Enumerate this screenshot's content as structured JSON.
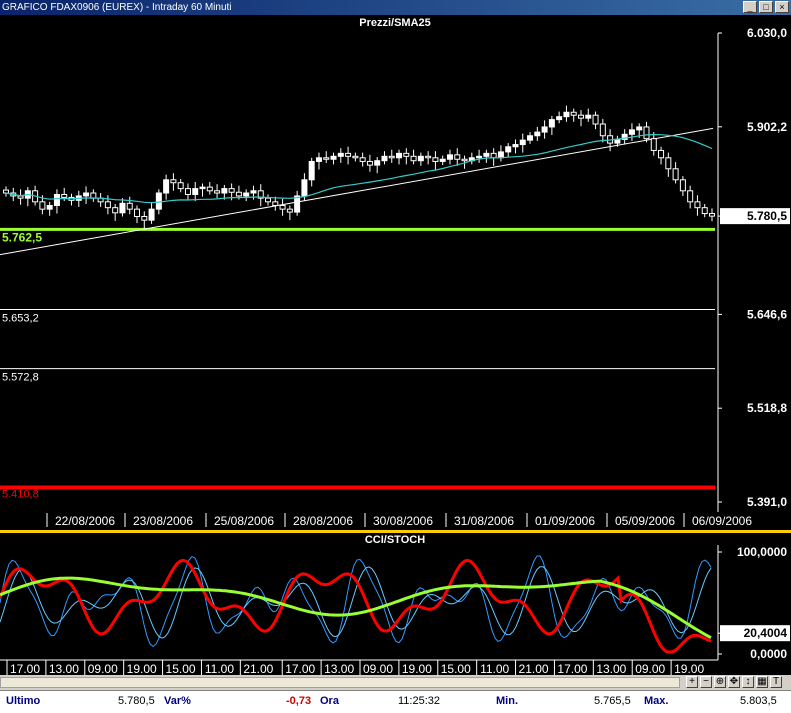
{
  "window": {
    "title": "GRAFICO FDAX0906 (EUREX) - Intraday 60 Minuti",
    "buttons": [
      "_",
      "□",
      "×"
    ]
  },
  "chart_data": [
    {
      "type": "candlestick",
      "title": "Prezzi/SMA25",
      "series": [
        {
          "name": "Prezzi"
        },
        {
          "name": "SMA25"
        }
      ],
      "y_ticks": [
        "6.030,0",
        "5.902,2",
        "5.780,5",
        "5.646,6",
        "5.518,8",
        "5.391,0"
      ],
      "ylim": [
        5391.0,
        6030.0
      ],
      "last_price": 5780.5,
      "last_price_label": "5.780,5",
      "support_line": {
        "value": 5762.5,
        "label": "5.762,5",
        "color": "#99ff33"
      },
      "levels": [
        {
          "value": 5653.2,
          "label": "5.653,2",
          "color": "#ffffff"
        },
        {
          "value": 5572.8,
          "label": "5.572,8",
          "color": "#ffffff"
        },
        {
          "value": 5410.8,
          "label": "5.410,8",
          "color": "#ff0000"
        }
      ],
      "date_labels": [
        "22/08/2006",
        "23/08/2006",
        "25/08/2006",
        "28/08/2006",
        "30/08/2006",
        "31/08/2006",
        "01/09/2006",
        "05/09/2006",
        "06/09/2006"
      ],
      "close_approx": [
        5812,
        5808,
        5805,
        5815,
        5800,
        5790,
        5795,
        5810,
        5806,
        5802,
        5808,
        5812,
        5805,
        5800,
        5792,
        5785,
        5798,
        5790,
        5780,
        5775,
        5790,
        5812,
        5830,
        5826,
        5818,
        5810,
        5818,
        5820,
        5815,
        5812,
        5818,
        5813,
        5808,
        5812,
        5815,
        5805,
        5800,
        5795,
        5790,
        5786,
        5808,
        5830,
        5855,
        5860,
        5858,
        5862,
        5866,
        5862,
        5860,
        5855,
        5850,
        5856,
        5862,
        5860,
        5866,
        5862,
        5856,
        5862,
        5860,
        5855,
        5858,
        5864,
        5858,
        5856,
        5860,
        5862,
        5866,
        5860,
        5868,
        5875,
        5878,
        5884,
        5890,
        5895,
        5902,
        5912,
        5916,
        5922,
        5918,
        5914,
        5918,
        5906,
        5890,
        5880,
        5885,
        5892,
        5898,
        5902,
        5886,
        5870,
        5860,
        5845,
        5830,
        5815,
        5800,
        5792,
        5784,
        5780.5
      ]
    },
    {
      "type": "line",
      "title": "CCI/STOCH",
      "series": [
        {
          "name": "CCI"
        },
        {
          "name": "STOCH"
        }
      ],
      "y_ticks": [
        "100,0000",
        "20,4004",
        "0,0000"
      ],
      "ylim": [
        0,
        100
      ],
      "last_value": 20.4004,
      "time_labels": [
        "17.00",
        "13.00",
        "09.00",
        "19.00",
        "15.00",
        "11.00",
        "21.00",
        "17.00",
        "13.00",
        "09.00",
        "19.00",
        "15.00",
        "11.00",
        "21.00",
        "17.00",
        "13.00",
        "09.00",
        "19.00"
      ]
    }
  ],
  "toolbar": {
    "buttons": [
      "+",
      "−",
      "⊕",
      "✥",
      "↕",
      "▦",
      "T"
    ]
  },
  "statusbar": {
    "ultimo_label": "Ultimo",
    "ultimo_value": "5.780,5",
    "var_label": "Var%",
    "var_value": "-0,73",
    "ora_label": "Ora",
    "ora_value": "11:25:32",
    "min_label": "Min.",
    "min_value": "5.765,5",
    "max_label": "Max.",
    "max_value": "5.803,5"
  },
  "colors": {
    "background": "#000000",
    "candle_up": "#ffffff",
    "candle_down": "#ffffff",
    "sma": "#33cccc",
    "trendline": "#ffffff",
    "support": "#99ff33",
    "level_red": "#ff0000",
    "cci": "#ff0000",
    "stoch_fast": "#3399ff",
    "stoch_slow": "#66ccff",
    "stoch_avg": "#99ff33",
    "separator": "#ffcc00"
  }
}
